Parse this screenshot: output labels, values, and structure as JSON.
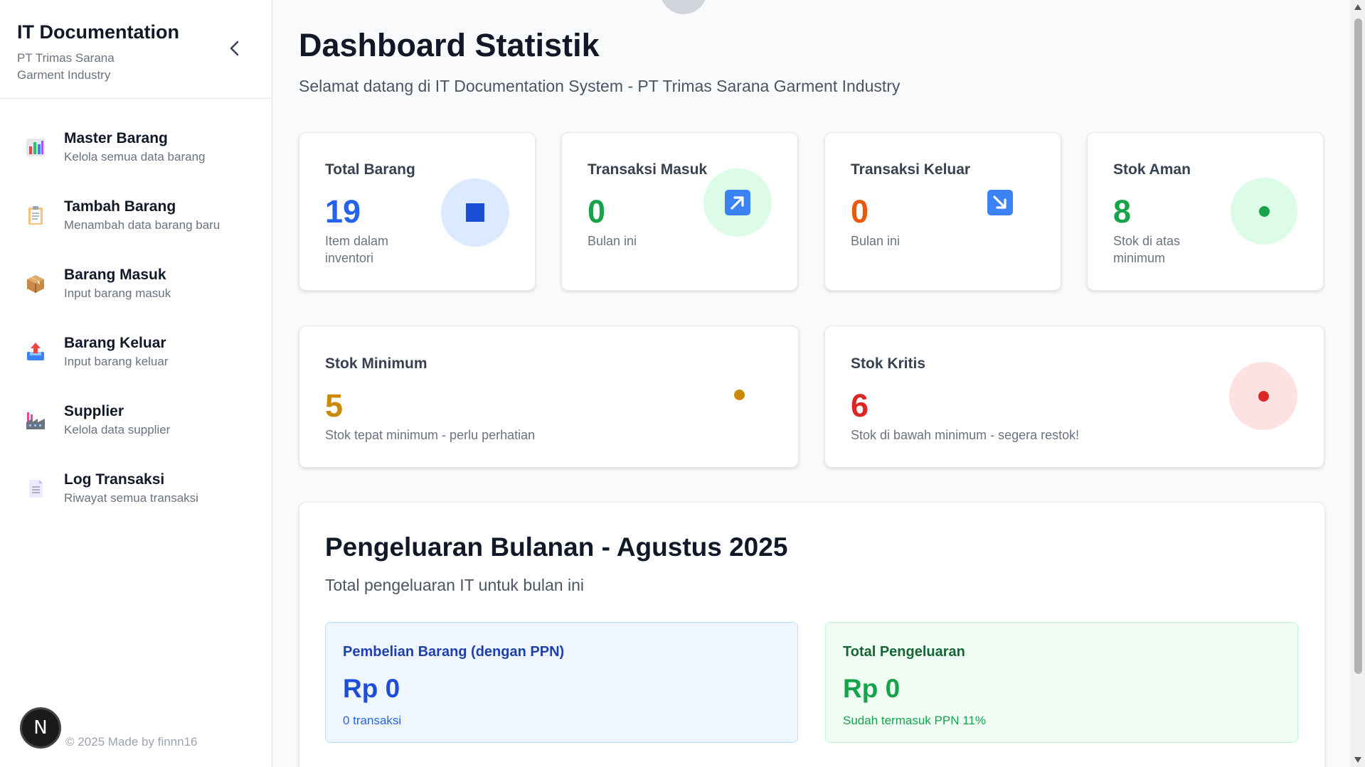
{
  "sidebar": {
    "title": "IT Documentation",
    "subtitle": "PT Trimas Sarana Garment Industry",
    "items": [
      {
        "label": "Master Barang",
        "desc": "Kelola semua data barang",
        "icon": "bar-chart-icon"
      },
      {
        "label": "Tambah Barang",
        "desc": "Menambah data barang baru",
        "icon": "clipboard-icon"
      },
      {
        "label": "Barang Masuk",
        "desc": "Input barang masuk",
        "icon": "package-icon"
      },
      {
        "label": "Barang Keluar",
        "desc": "Input barang keluar",
        "icon": "outbox-tray-icon"
      },
      {
        "label": "Supplier",
        "desc": "Kelola data supplier",
        "icon": "factory-icon"
      },
      {
        "label": "Log Transaksi",
        "desc": "Riwayat semua transaksi",
        "icon": "document-icon"
      }
    ],
    "footer": "© 2025 Made by finnn16",
    "badge": "N"
  },
  "header": {
    "title": "Dashboard Statistik",
    "subtitle": "Selamat datang di IT Documentation System - PT Trimas Sarana Garment Industry"
  },
  "stats": {
    "total_barang": {
      "label": "Total Barang",
      "value": "19",
      "note": "Item dalam inventori",
      "color": "#2563eb"
    },
    "transaksi_masuk": {
      "label": "Transaksi Masuk",
      "value": "0",
      "note": "Bulan ini",
      "color": "#16a34a"
    },
    "transaksi_keluar": {
      "label": "Transaksi Keluar",
      "value": "0",
      "note": "Bulan ini",
      "color": "#ea580c"
    },
    "stok_aman": {
      "label": "Stok Aman",
      "value": "8",
      "note": "Stok di atas minimum",
      "color": "#16a34a"
    },
    "stok_minimum": {
      "label": "Stok Minimum",
      "value": "5",
      "note": "Stok tepat minimum - perlu perhatian",
      "color": "#ca8a04"
    },
    "stok_kritis": {
      "label": "Stok Kritis",
      "value": "6",
      "note": "Stok di bawah minimum - segera restok!",
      "color": "#dc2626"
    }
  },
  "expenses": {
    "title": "Pengeluaran Bulanan - Agustus 2025",
    "subtitle": "Total pengeluaran IT untuk bulan ini",
    "purchase": {
      "label": "Pembelian Barang (dengan PPN)",
      "value": "Rp 0",
      "note": "0 transaksi"
    },
    "total": {
      "label": "Total Pengeluaran",
      "value": "Rp 0",
      "note": "Sudah termasuk PPN 11%"
    }
  }
}
